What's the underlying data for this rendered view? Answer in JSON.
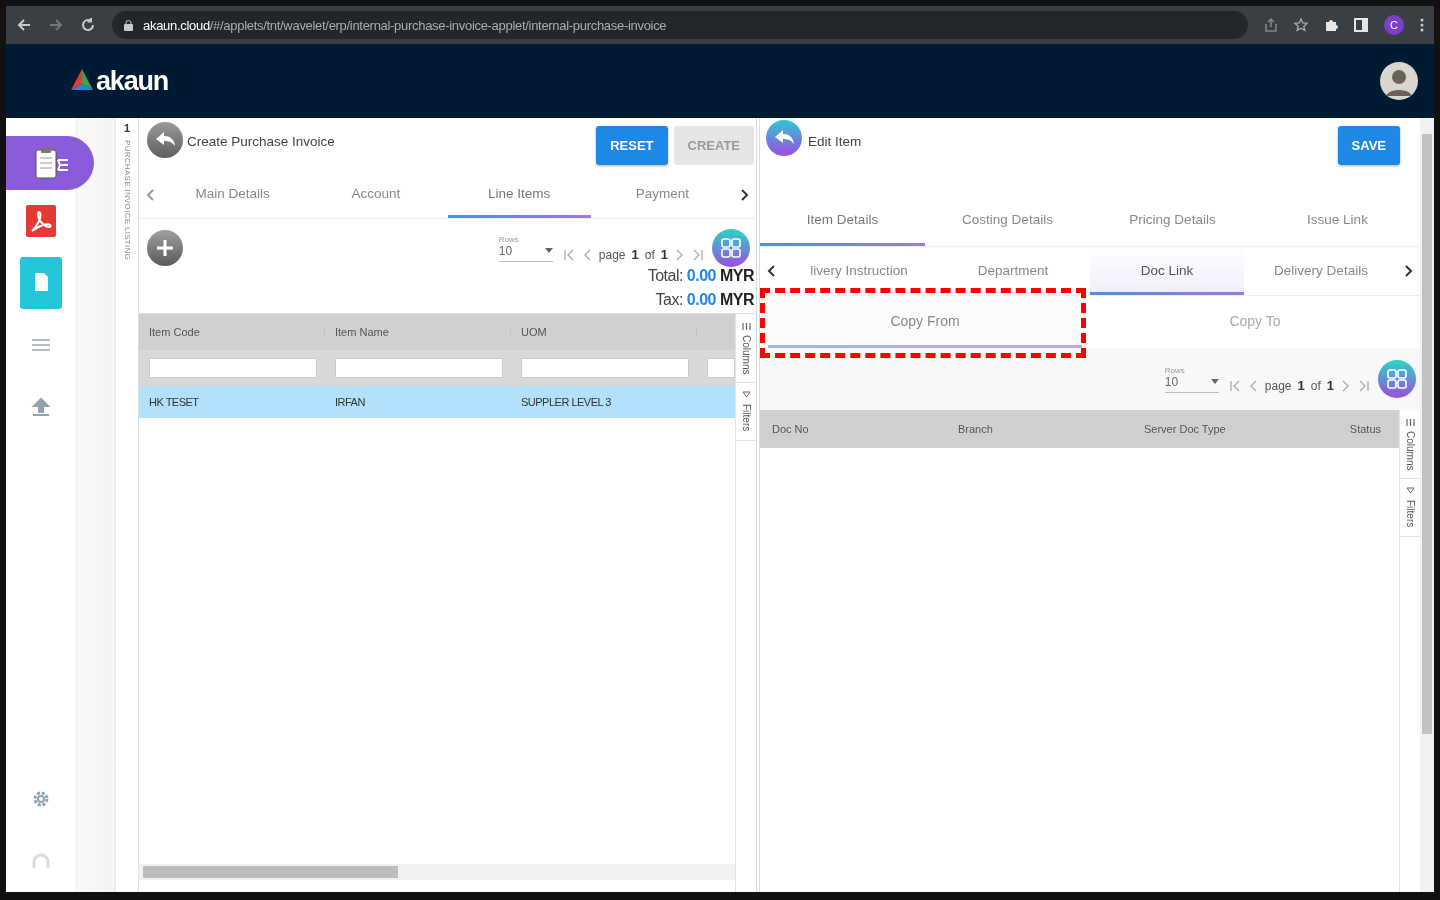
{
  "browser": {
    "url_host": "akaun.cloud",
    "url_path": "/#/applets/tnt/wavelet/erp/internal-purchase-invoice-applet/internal-purchase-invoice",
    "profile_initial": "C"
  },
  "app_header": {
    "logo": "akaun"
  },
  "sidebar": {
    "items": [
      {
        "kind": "clipboard",
        "selected": true
      },
      {
        "kind": "pdf",
        "selected": false
      },
      {
        "kind": "document",
        "selected": false
      },
      {
        "kind": "list",
        "selected": false
      },
      {
        "kind": "upload",
        "selected": false
      }
    ],
    "bottom_items": [
      {
        "kind": "settings"
      },
      {
        "kind": "headset"
      }
    ]
  },
  "listing_strip": {
    "count": "1",
    "label": "PURCHASE INVOICE LISTING"
  },
  "left_panel": {
    "title": "Create Purchase Invoice",
    "buttons": [
      {
        "label": "RESET",
        "disabled": false
      },
      {
        "label": "CREATE",
        "disabled": true
      }
    ],
    "tabs": [
      {
        "label": "Main Details",
        "selected": false
      },
      {
        "label": "Account",
        "selected": false
      },
      {
        "label": "Line Items",
        "selected": true
      },
      {
        "label": "Payment",
        "selected": false
      }
    ],
    "pager": {
      "rows_label": "Rows",
      "rows_value": "10",
      "page_word": "page",
      "page": "1",
      "of_word": "of",
      "total_pages": "1"
    },
    "totals": [
      {
        "label": "Total:",
        "amount": "0.00",
        "currency": "MYR"
      },
      {
        "label": "Tax:",
        "amount": "0.00",
        "currency": "MYR"
      }
    ],
    "table": {
      "columns": [
        "Item Code",
        "Item Name",
        "UOM"
      ],
      "rows": [
        {
          "cells": [
            "HK TESET",
            "IRFAN",
            "SUPPLER LEVEL 3"
          ],
          "selected": true
        }
      ]
    },
    "side_tools": [
      "Columns",
      "Filters"
    ]
  },
  "right_panel": {
    "title": "Edit Item",
    "buttons": [
      {
        "label": "SAVE",
        "disabled": false
      }
    ],
    "tabs": [
      {
        "label": "Item Details",
        "selected": true
      },
      {
        "label": "Costing Details",
        "selected": false
      },
      {
        "label": "Pricing Details",
        "selected": false
      },
      {
        "label": "Issue Link",
        "selected": false
      }
    ],
    "sub_tabs": [
      {
        "label": "livery Instruction",
        "selected": false
      },
      {
        "label": "Department",
        "selected": false
      },
      {
        "label": "Doc Link",
        "selected": true
      },
      {
        "label": "Delivery Details",
        "selected": false
      }
    ],
    "link_tabs": [
      {
        "label": "Copy From",
        "selected": true,
        "annotated": true
      },
      {
        "label": "Copy To",
        "selected": false,
        "annotated": false
      }
    ],
    "pager": {
      "rows_label": "Rows",
      "rows_value": "10",
      "page_word": "page",
      "page": "1",
      "of_word": "of",
      "total_pages": "1"
    },
    "table": {
      "columns": [
        "Doc No",
        "Branch",
        "Server Doc Type",
        "Status"
      ]
    },
    "side_tools": [
      "Columns",
      "Filters"
    ]
  }
}
